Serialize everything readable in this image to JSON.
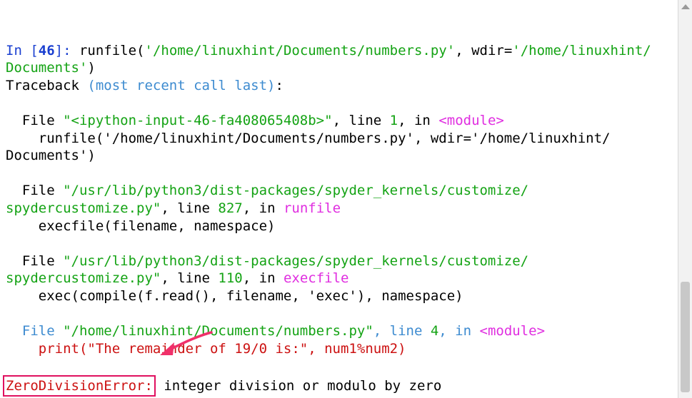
{
  "console": {
    "lines": [
      [],
      [
        {
          "text": "In [",
          "color": "#1a3fd0",
          "bold": false
        },
        {
          "text": "46",
          "color": "#1a3fd0",
          "bold": true
        },
        {
          "text": "]: ",
          "color": "#1a3fd0",
          "bold": false
        },
        {
          "text": "runfile(",
          "color": "#000000"
        },
        {
          "text": "'/home/linuxhint/Documents/numbers.py'",
          "color": "#14a314"
        },
        {
          "text": ", wdir=",
          "color": "#000000"
        },
        {
          "text": "'/home/linuxhint/",
          "color": "#14a314"
        }
      ],
      [
        {
          "text": "Documents'",
          "color": "#14a314"
        },
        {
          "text": ")",
          "color": "#000000"
        }
      ],
      [
        {
          "text": "Traceback ",
          "color": "#000000"
        },
        {
          "text": "(most recent call last)",
          "color": "#3d8bd0"
        },
        {
          "text": ":",
          "color": "#000000"
        }
      ],
      [],
      [
        {
          "text": "  File ",
          "color": "#000000"
        },
        {
          "text": "\"<ipython-input-46-fa408065408b>\"",
          "color": "#14a314"
        },
        {
          "text": ", line ",
          "color": "#000000"
        },
        {
          "text": "1",
          "color": "#14a314"
        },
        {
          "text": ", in ",
          "color": "#000000"
        },
        {
          "text": "<module>",
          "color": "#e02ee0"
        }
      ],
      [
        {
          "text": "    runfile('/home/linuxhint/Documents/numbers.py', wdir='/home/linuxhint/",
          "color": "#000000"
        }
      ],
      [
        {
          "text": "Documents')",
          "color": "#000000"
        }
      ],
      [],
      [
        {
          "text": "  File ",
          "color": "#000000"
        },
        {
          "text": "\"/usr/lib/python3/dist-packages/spyder_kernels/customize/",
          "color": "#14a314"
        }
      ],
      [
        {
          "text": "spydercustomize.py\"",
          "color": "#14a314"
        },
        {
          "text": ", line ",
          "color": "#000000"
        },
        {
          "text": "827",
          "color": "#14a314"
        },
        {
          "text": ", in ",
          "color": "#000000"
        },
        {
          "text": "runfile",
          "color": "#e02ee0"
        }
      ],
      [
        {
          "text": "    execfile(filename, namespace)",
          "color": "#000000"
        }
      ],
      [],
      [
        {
          "text": "  File ",
          "color": "#000000"
        },
        {
          "text": "\"/usr/lib/python3/dist-packages/spyder_kernels/customize/",
          "color": "#14a314"
        }
      ],
      [
        {
          "text": "spydercustomize.py\"",
          "color": "#14a314"
        },
        {
          "text": ", line ",
          "color": "#000000"
        },
        {
          "text": "110",
          "color": "#14a314"
        },
        {
          "text": ", in ",
          "color": "#000000"
        },
        {
          "text": "execfile",
          "color": "#e02ee0"
        }
      ],
      [
        {
          "text": "    exec(compile(f.read(), filename, 'exec'), namespace)",
          "color": "#000000"
        }
      ],
      [],
      [
        {
          "text": "  File ",
          "color": "#3d8bd0"
        },
        {
          "text": "\"/home/linuxhint/Documents/numbers.py\"",
          "color": "#14a314"
        },
        {
          "text": ", line ",
          "color": "#3d8bd0"
        },
        {
          "text": "4",
          "color": "#14a314"
        },
        {
          "text": ", in ",
          "color": "#3d8bd0"
        },
        {
          "text": "<module>",
          "color": "#e02ee0"
        }
      ],
      [
        {
          "text": "    print(\"The remainder of 19/0 is:\", num1%num2)",
          "color": "#cc1111"
        }
      ],
      [],
      [
        {
          "text": "ZeroDivisionError:",
          "color": "#cc1111",
          "boxed": true
        },
        {
          "text": " integer division or modulo by zero",
          "color": "#000000"
        }
      ]
    ]
  },
  "colors": {
    "highlight_box": "#e0105f",
    "arrow": "#f0306a"
  }
}
